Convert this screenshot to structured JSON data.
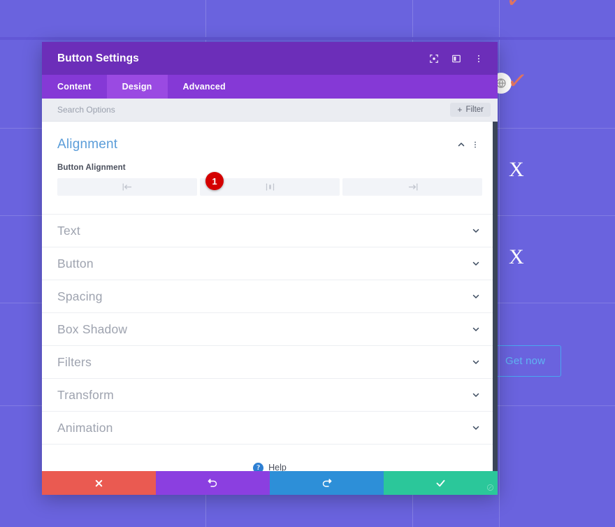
{
  "background": {
    "bg_color": "#6a63de",
    "marks": [
      {
        "type": "x",
        "label": "X"
      },
      {
        "type": "x",
        "label": "X"
      }
    ],
    "check_top": "✓",
    "check_mid": "✓",
    "cta_button": "Get now"
  },
  "modal": {
    "title": "Button Settings",
    "header_icons": [
      {
        "name": "focus-target-icon"
      },
      {
        "name": "layout-panel-icon"
      },
      {
        "name": "more-vertical-icon"
      }
    ],
    "tabs": [
      {
        "label": "Content",
        "active": false
      },
      {
        "label": "Design",
        "active": true
      },
      {
        "label": "Advanced",
        "active": false
      }
    ],
    "search": {
      "placeholder": "Search Options",
      "value": "",
      "filter_label": "Filter",
      "filter_plus": "+"
    },
    "alignment_section": {
      "title": "Alignment",
      "collapse_icon": "chevron-up-icon",
      "menu_icon": "more-vertical-icon",
      "field_label": "Button Alignment",
      "options": [
        {
          "name": "align-left",
          "icon": "align-left-icon"
        },
        {
          "name": "align-center",
          "icon": "align-center-icon"
        },
        {
          "name": "align-right",
          "icon": "align-right-icon"
        }
      ],
      "badge": "1",
      "badge_color": "#d40000"
    },
    "collapsed_sections": [
      {
        "label": "Text"
      },
      {
        "label": "Button"
      },
      {
        "label": "Spacing"
      },
      {
        "label": "Box Shadow"
      },
      {
        "label": "Filters"
      },
      {
        "label": "Transform"
      },
      {
        "label": "Animation"
      }
    ],
    "help": {
      "icon_glyph": "?",
      "label": "Help"
    },
    "footer_buttons": [
      {
        "name": "cancel-button",
        "icon": "close-icon",
        "color": "#ea5a51"
      },
      {
        "name": "undo-button",
        "icon": "undo-icon",
        "color": "#8b3fe0"
      },
      {
        "name": "redo-button",
        "icon": "redo-icon",
        "color": "#2d8fd8"
      },
      {
        "name": "save-button",
        "icon": "check-icon",
        "color": "#2bc79a"
      }
    ]
  }
}
